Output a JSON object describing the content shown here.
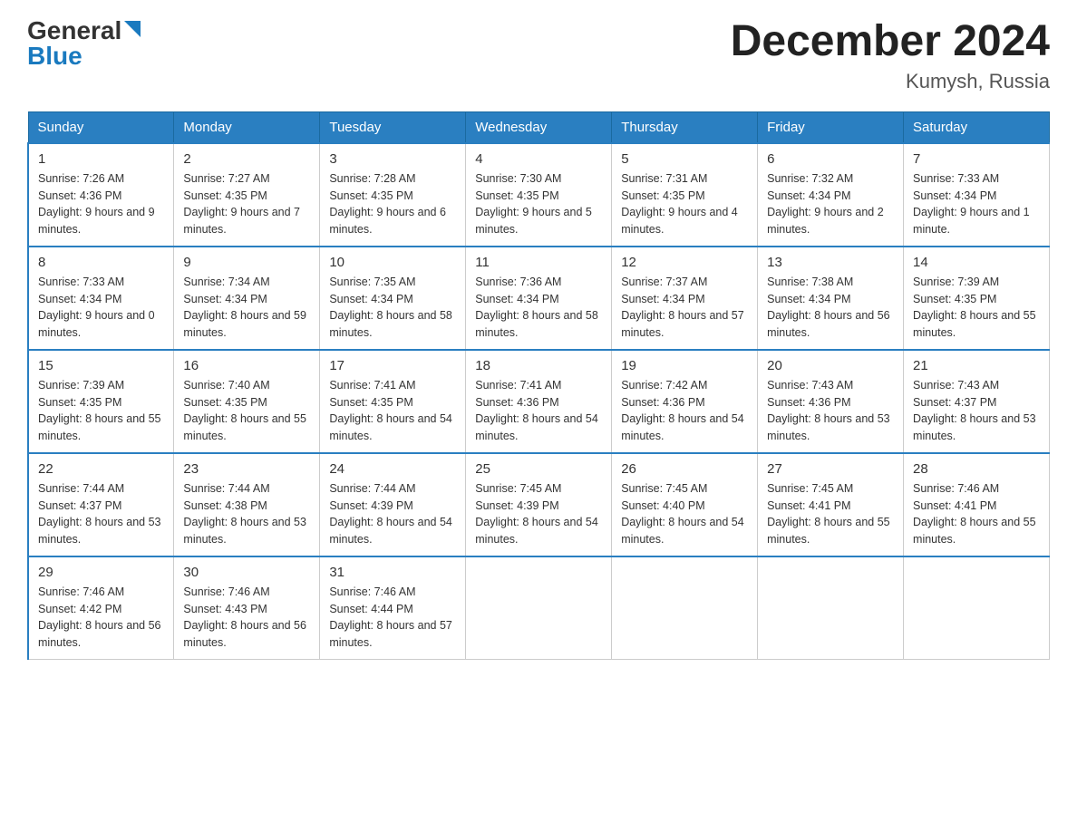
{
  "header": {
    "logo_general": "General",
    "logo_blue": "Blue",
    "title": "December 2024",
    "subtitle": "Kumysh, Russia"
  },
  "days_of_week": [
    "Sunday",
    "Monday",
    "Tuesday",
    "Wednesday",
    "Thursday",
    "Friday",
    "Saturday"
  ],
  "weeks": [
    [
      {
        "day": "1",
        "sunrise": "7:26 AM",
        "sunset": "4:36 PM",
        "daylight": "9 hours and 9 minutes."
      },
      {
        "day": "2",
        "sunrise": "7:27 AM",
        "sunset": "4:35 PM",
        "daylight": "9 hours and 7 minutes."
      },
      {
        "day": "3",
        "sunrise": "7:28 AM",
        "sunset": "4:35 PM",
        "daylight": "9 hours and 6 minutes."
      },
      {
        "day": "4",
        "sunrise": "7:30 AM",
        "sunset": "4:35 PM",
        "daylight": "9 hours and 5 minutes."
      },
      {
        "day": "5",
        "sunrise": "7:31 AM",
        "sunset": "4:35 PM",
        "daylight": "9 hours and 4 minutes."
      },
      {
        "day": "6",
        "sunrise": "7:32 AM",
        "sunset": "4:34 PM",
        "daylight": "9 hours and 2 minutes."
      },
      {
        "day": "7",
        "sunrise": "7:33 AM",
        "sunset": "4:34 PM",
        "daylight": "9 hours and 1 minute."
      }
    ],
    [
      {
        "day": "8",
        "sunrise": "7:33 AM",
        "sunset": "4:34 PM",
        "daylight": "9 hours and 0 minutes."
      },
      {
        "day": "9",
        "sunrise": "7:34 AM",
        "sunset": "4:34 PM",
        "daylight": "8 hours and 59 minutes."
      },
      {
        "day": "10",
        "sunrise": "7:35 AM",
        "sunset": "4:34 PM",
        "daylight": "8 hours and 58 minutes."
      },
      {
        "day": "11",
        "sunrise": "7:36 AM",
        "sunset": "4:34 PM",
        "daylight": "8 hours and 58 minutes."
      },
      {
        "day": "12",
        "sunrise": "7:37 AM",
        "sunset": "4:34 PM",
        "daylight": "8 hours and 57 minutes."
      },
      {
        "day": "13",
        "sunrise": "7:38 AM",
        "sunset": "4:34 PM",
        "daylight": "8 hours and 56 minutes."
      },
      {
        "day": "14",
        "sunrise": "7:39 AM",
        "sunset": "4:35 PM",
        "daylight": "8 hours and 55 minutes."
      }
    ],
    [
      {
        "day": "15",
        "sunrise": "7:39 AM",
        "sunset": "4:35 PM",
        "daylight": "8 hours and 55 minutes."
      },
      {
        "day": "16",
        "sunrise": "7:40 AM",
        "sunset": "4:35 PM",
        "daylight": "8 hours and 55 minutes."
      },
      {
        "day": "17",
        "sunrise": "7:41 AM",
        "sunset": "4:35 PM",
        "daylight": "8 hours and 54 minutes."
      },
      {
        "day": "18",
        "sunrise": "7:41 AM",
        "sunset": "4:36 PM",
        "daylight": "8 hours and 54 minutes."
      },
      {
        "day": "19",
        "sunrise": "7:42 AM",
        "sunset": "4:36 PM",
        "daylight": "8 hours and 54 minutes."
      },
      {
        "day": "20",
        "sunrise": "7:43 AM",
        "sunset": "4:36 PM",
        "daylight": "8 hours and 53 minutes."
      },
      {
        "day": "21",
        "sunrise": "7:43 AM",
        "sunset": "4:37 PM",
        "daylight": "8 hours and 53 minutes."
      }
    ],
    [
      {
        "day": "22",
        "sunrise": "7:44 AM",
        "sunset": "4:37 PM",
        "daylight": "8 hours and 53 minutes."
      },
      {
        "day": "23",
        "sunrise": "7:44 AM",
        "sunset": "4:38 PM",
        "daylight": "8 hours and 53 minutes."
      },
      {
        "day": "24",
        "sunrise": "7:44 AM",
        "sunset": "4:39 PM",
        "daylight": "8 hours and 54 minutes."
      },
      {
        "day": "25",
        "sunrise": "7:45 AM",
        "sunset": "4:39 PM",
        "daylight": "8 hours and 54 minutes."
      },
      {
        "day": "26",
        "sunrise": "7:45 AM",
        "sunset": "4:40 PM",
        "daylight": "8 hours and 54 minutes."
      },
      {
        "day": "27",
        "sunrise": "7:45 AM",
        "sunset": "4:41 PM",
        "daylight": "8 hours and 55 minutes."
      },
      {
        "day": "28",
        "sunrise": "7:46 AM",
        "sunset": "4:41 PM",
        "daylight": "8 hours and 55 minutes."
      }
    ],
    [
      {
        "day": "29",
        "sunrise": "7:46 AM",
        "sunset": "4:42 PM",
        "daylight": "8 hours and 56 minutes."
      },
      {
        "day": "30",
        "sunrise": "7:46 AM",
        "sunset": "4:43 PM",
        "daylight": "8 hours and 56 minutes."
      },
      {
        "day": "31",
        "sunrise": "7:46 AM",
        "sunset": "4:44 PM",
        "daylight": "8 hours and 57 minutes."
      },
      null,
      null,
      null,
      null
    ]
  ]
}
